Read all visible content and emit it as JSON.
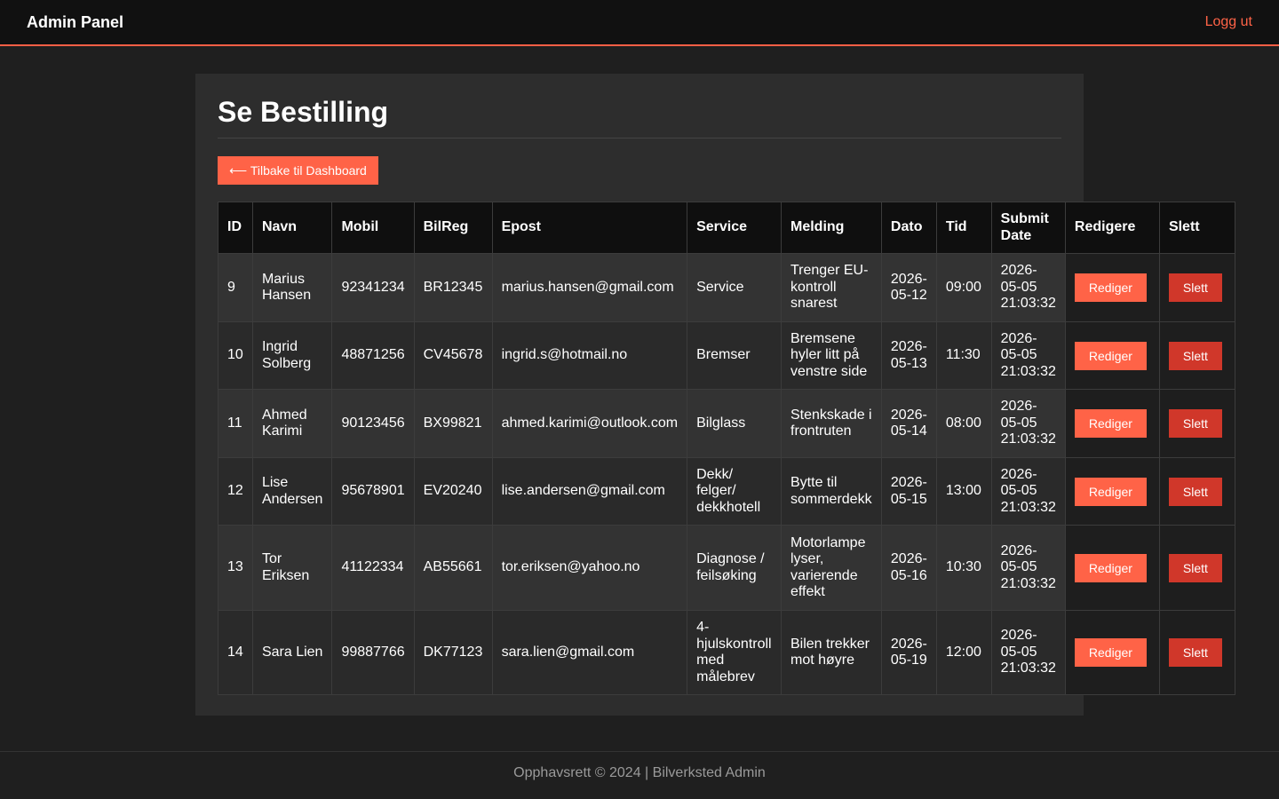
{
  "header": {
    "brand": "Admin Panel",
    "logout_label": "Logg ut"
  },
  "page": {
    "title": "Se Bestilling",
    "back_label": "⟵ Tilbake til Dashboard"
  },
  "table": {
    "columns": [
      "ID",
      "Navn",
      "Mobil",
      "BilReg",
      "Epost",
      "Service",
      "Melding",
      "Dato",
      "Tid",
      "Submit Date",
      "Redigere",
      "Slett"
    ],
    "edit_label": "Rediger",
    "delete_label": "Slett",
    "rows": [
      {
        "id": "9",
        "name": "Marius Hansen",
        "mobile": "92341234",
        "reg": "BR12345",
        "email": "marius.hansen@gmail.com",
        "service": "Service",
        "message": "Trenger EU-kontroll snarest",
        "date": "2026-05-12",
        "time": "09:00",
        "submitted": "2026-05-05 21:03:32"
      },
      {
        "id": "10",
        "name": "Ingrid Solberg",
        "mobile": "48871256",
        "reg": "CV45678",
        "email": "ingrid.s@hotmail.no",
        "service": "Bremser",
        "message": "Bremsene hyler litt på venstre side",
        "date": "2026-05-13",
        "time": "11:30",
        "submitted": "2026-05-05 21:03:32"
      },
      {
        "id": "11",
        "name": "Ahmed Karimi",
        "mobile": "90123456",
        "reg": "BX99821",
        "email": "ahmed.karimi@outlook.com",
        "service": "Bilglass",
        "message": "Stenkskade i frontruten",
        "date": "2026-05-14",
        "time": "08:00",
        "submitted": "2026-05-05 21:03:32"
      },
      {
        "id": "12",
        "name": "Lise Andersen",
        "mobile": "95678901",
        "reg": "EV20240",
        "email": "lise.andersen@gmail.com",
        "service": "Dekk/ felger/ dekkhotell",
        "message": "Bytte til sommerdekk",
        "date": "2026-05-15",
        "time": "13:00",
        "submitted": "2026-05-05 21:03:32"
      },
      {
        "id": "13",
        "name": "Tor Eriksen",
        "mobile": "41122334",
        "reg": "AB55661",
        "email": "tor.eriksen@yahoo.no",
        "service": "Diagnose / feilsøking",
        "message": "Motorlampe lyser, varierende effekt",
        "date": "2026-05-16",
        "time": "10:30",
        "submitted": "2026-05-05 21:03:32"
      },
      {
        "id": "14",
        "name": "Sara Lien",
        "mobile": "99887766",
        "reg": "DK77123",
        "email": "sara.lien@gmail.com",
        "service": "4-hjulskontroll med målebrev",
        "message": "Bilen trekker mot høyre",
        "date": "2026-05-19",
        "time": "12:00",
        "submitted": "2026-05-05 21:03:32"
      }
    ]
  },
  "footer": {
    "text": "Opphavsrett © 2024 | Bilverksted Admin"
  }
}
